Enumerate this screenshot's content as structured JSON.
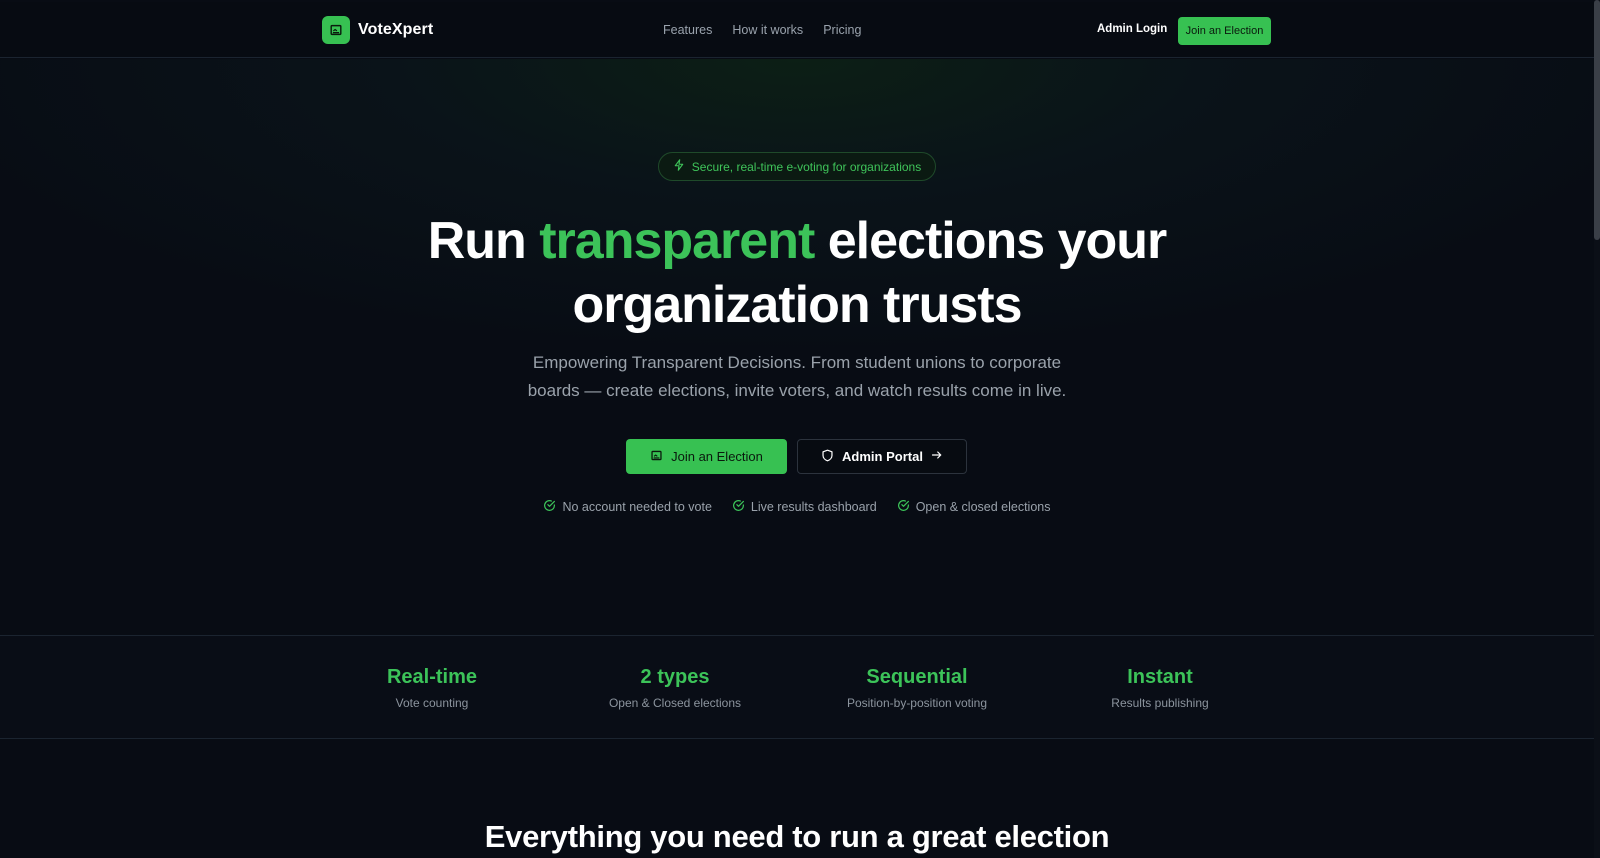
{
  "header": {
    "brand": "VoteXpert",
    "nav": [
      "Features",
      "How it works",
      "Pricing"
    ],
    "admin_login": "Admin Login",
    "join_label": "Join an Election"
  },
  "hero": {
    "badge": "Secure, real-time e-voting for organizations",
    "headline_pre": "Run ",
    "headline_accent": "transparent",
    "headline_post": " elections your",
    "headline_line2": "organization trusts",
    "subtitle_line1": "Empowering Transparent Decisions. From student unions to corporate",
    "subtitle_line2": "boards — create elections, invite voters, and watch results come in live.",
    "cta_primary": "Join an Election",
    "cta_secondary": "Admin Portal",
    "checks": [
      "No account needed to vote",
      "Live results dashboard",
      "Open & closed elections"
    ]
  },
  "stats": [
    {
      "value": "Real-time",
      "label": "Vote counting"
    },
    {
      "value": "2 types",
      "label": "Open & Closed elections"
    },
    {
      "value": "Sequential",
      "label": "Position-by-position voting"
    },
    {
      "value": "Instant",
      "label": "Results publishing"
    }
  ],
  "section": {
    "title": "Everything you need to run a great election"
  },
  "colors": {
    "accent": "#37c152",
    "background": "#080c14"
  },
  "icons": {
    "brand": "ballot-icon",
    "badge": "lightning-icon",
    "cta_primary": "ballot-icon",
    "cta_secondary": "shield-icon",
    "cta_secondary_trailing": "arrow-right-icon",
    "checks": "check-circle-icon"
  }
}
